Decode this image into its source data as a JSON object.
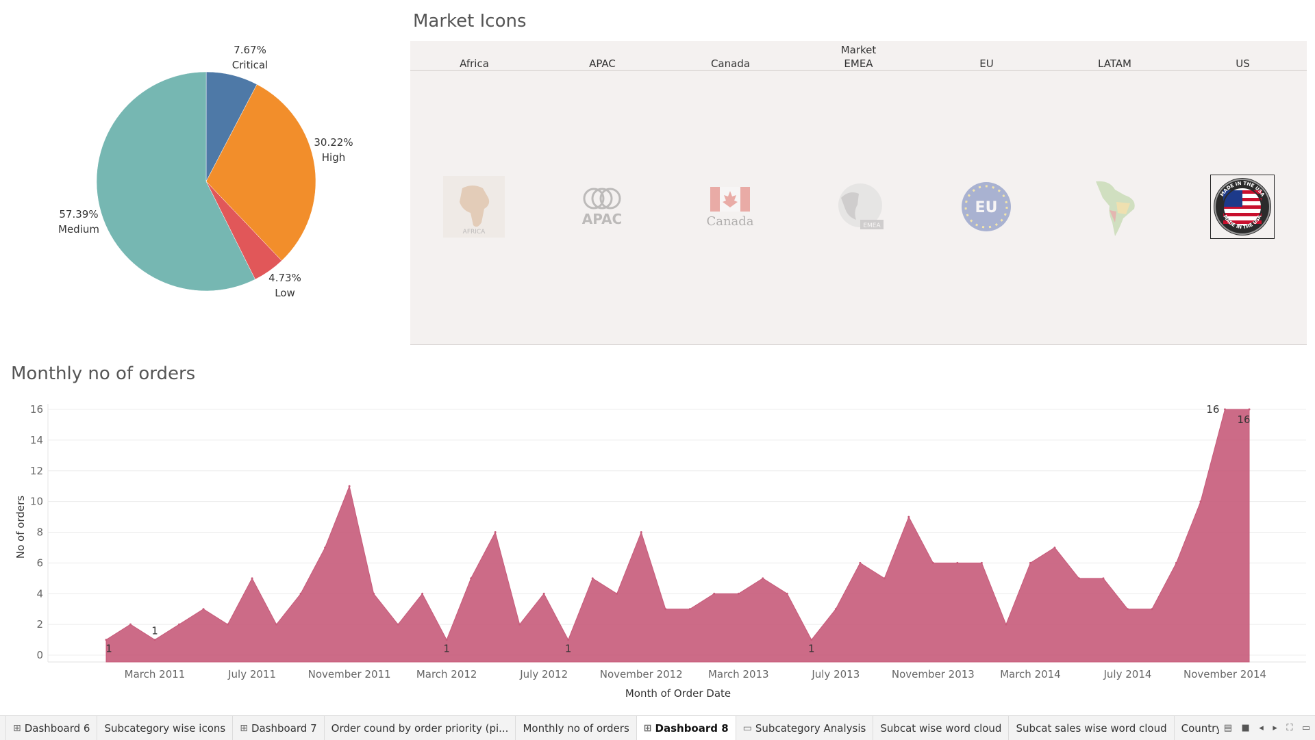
{
  "pie": {
    "slices": [
      {
        "name": "Critical",
        "percent": 7.67,
        "label": "7.67%",
        "color": "#4e79a7"
      },
      {
        "name": "High",
        "percent": 30.22,
        "label": "30.22%",
        "color": "#f28e2b"
      },
      {
        "name": "Low",
        "percent": 4.73,
        "label": "4.73%",
        "color": "#e15759"
      },
      {
        "name": "Medium",
        "percent": 57.39,
        "label": "57.39%",
        "color": "#76b7b2"
      }
    ]
  },
  "market": {
    "title": "Market Icons",
    "header": "Market",
    "columns": [
      {
        "label": "Africa",
        "icon": "africa-map-icon"
      },
      {
        "label": "APAC",
        "icon": "apac-logo-icon"
      },
      {
        "label": "Canada",
        "icon": "canada-flag-icon"
      },
      {
        "label": "EMEA",
        "icon": "emea-globe-icon"
      },
      {
        "label": "EU",
        "icon": "eu-badge-icon"
      },
      {
        "label": "LATAM",
        "icon": "latam-map-icon"
      },
      {
        "label": "US",
        "icon": "made-in-usa-badge-icon"
      }
    ],
    "icon_text": {
      "africa": "AFRICA",
      "apac": "APAC",
      "canada": "Canada",
      "emea": "EMEA",
      "eu": "EU",
      "usa_top": "MADE IN THE USA",
      "usa_bottom": "MADE IN THE USA"
    },
    "selected": "US"
  },
  "monthly": {
    "title": "Monthly no of orders"
  },
  "chart_data": {
    "type": "area",
    "title": "Monthly no of orders",
    "xlabel": "Month of Order Date",
    "ylabel": "No of orders",
    "ylim": [
      0,
      16
    ],
    "yticks": [
      0,
      2,
      4,
      6,
      8,
      10,
      12,
      14,
      16
    ],
    "x_tick_labels": [
      "March 2011",
      "July 2011",
      "November 2011",
      "March 2012",
      "July 2012",
      "November 2012",
      "March 2013",
      "July 2013",
      "November 2013",
      "March 2014",
      "July 2014",
      "November 2014"
    ],
    "x_tick_months": [
      2,
      6,
      10,
      14,
      18,
      22,
      26,
      30,
      34,
      38,
      42,
      46
    ],
    "months": [
      "Jan 2011",
      "Feb 2011",
      "Mar 2011",
      "Apr 2011",
      "May 2011",
      "Jun 2011",
      "Jul 2011",
      "Aug 2011",
      "Sep 2011",
      "Oct 2011",
      "Nov 2011",
      "Dec 2011",
      "Jan 2012",
      "Feb 2012",
      "Mar 2012",
      "Apr 2012",
      "May 2012",
      "Jun 2012",
      "Jul 2012",
      "Aug 2012",
      "Sep 2012",
      "Oct 2012",
      "Nov 2012",
      "Dec 2012",
      "Jan 2013",
      "Feb 2013",
      "Mar 2013",
      "Apr 2013",
      "May 2013",
      "Jun 2013",
      "Jul 2013",
      "Aug 2013",
      "Sep 2013",
      "Oct 2013",
      "Nov 2013",
      "Dec 2013",
      "Jan 2014",
      "Feb 2014",
      "Mar 2014",
      "Apr 2014",
      "May 2014",
      "Jun 2014",
      "Jul 2014",
      "Aug 2014",
      "Sep 2014",
      "Oct 2014",
      "Nov 2014",
      "Dec 2014"
    ],
    "values": [
      1,
      2,
      1,
      2,
      3,
      2,
      5,
      2,
      4,
      7,
      11,
      4,
      2,
      4,
      1,
      5,
      8,
      2,
      4,
      1,
      5,
      4,
      8,
      3,
      3,
      4,
      4,
      5,
      4,
      1,
      3,
      6,
      5,
      9,
      6,
      6,
      6,
      2,
      6,
      7,
      5,
      5,
      3,
      3,
      6,
      10,
      16,
      16
    ],
    "data_labels": [
      {
        "index": 0,
        "text": "1"
      },
      {
        "index": 2,
        "text": "1"
      },
      {
        "index": 14,
        "text": "1"
      },
      {
        "index": 19,
        "text": "1"
      },
      {
        "index": 29,
        "text": "1"
      },
      {
        "index": 46,
        "text": "16"
      },
      {
        "index": 47,
        "text": "16"
      }
    ],
    "color": "#c75b7a",
    "grid": true
  },
  "tabs": [
    {
      "label": "Dashboard 6",
      "icon": "dashboard-icon",
      "active": false
    },
    {
      "label": "Subcategory wise icons",
      "icon": "",
      "active": false
    },
    {
      "label": "Dashboard 7",
      "icon": "dashboard-icon",
      "active": false
    },
    {
      "label": "Order cound by order priority (pi...",
      "icon": "",
      "active": false
    },
    {
      "label": "Monthly no of orders",
      "icon": "",
      "active": false
    },
    {
      "label": "Dashboard 8",
      "icon": "dashboard-icon",
      "active": true
    },
    {
      "label": "Subcategory Analysis",
      "icon": "story-icon",
      "active": false
    },
    {
      "label": "Subcat wise word cloud",
      "icon": "",
      "active": false
    },
    {
      "label": "Subcat sales wise word cloud",
      "icon": "",
      "active": false
    },
    {
      "label": "Countrywise profit word clo",
      "icon": "",
      "active": false
    }
  ]
}
